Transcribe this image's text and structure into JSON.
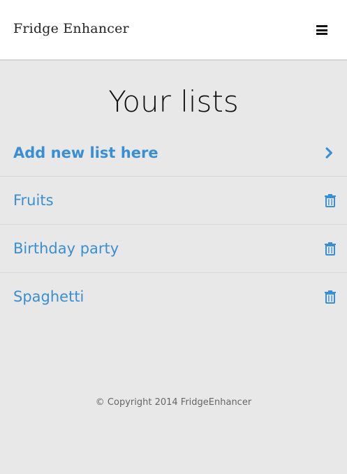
{
  "header": {
    "brand": "Fridge Enhancer",
    "menu_icon": "hamburger-menu-icon"
  },
  "main": {
    "title": "Your lists",
    "add_item": {
      "label": "Add new list here",
      "icon": "chevron-right-icon"
    },
    "lists": [
      {
        "label": "Fruits",
        "icon": "trash-icon"
      },
      {
        "label": "Birthday party",
        "icon": "trash-icon"
      },
      {
        "label": "Spaghetti",
        "icon": "trash-icon"
      }
    ]
  },
  "footer": {
    "copyright": "© Copyright 2014 FridgeEnhancer"
  },
  "colors": {
    "accent": "#3a8fd4",
    "background": "#e8e8e8",
    "header_bg": "#ffffff"
  }
}
